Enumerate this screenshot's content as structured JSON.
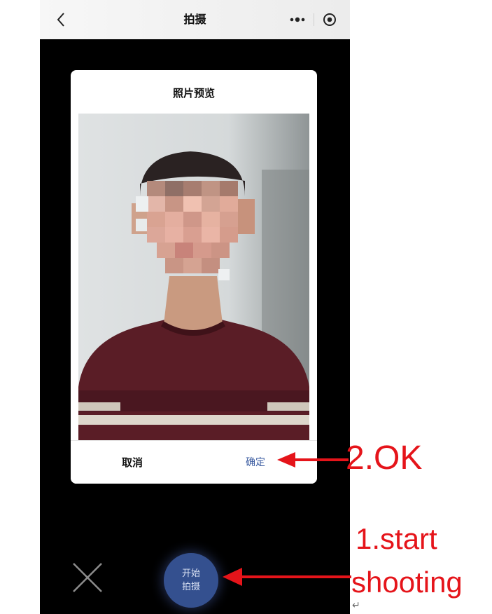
{
  "navbar": {
    "title": "拍摄",
    "back_icon": "chevron-left-icon",
    "more_icon": "more-dots-icon",
    "close_icon": "target-circle-icon"
  },
  "dialog": {
    "title": "照片预览",
    "cancel_label": "取消",
    "confirm_label": "确定",
    "confirm_color": "#3a5ba0"
  },
  "camera": {
    "shoot_label_line1": "开始",
    "shoot_label_line2": "拍摄",
    "close_icon": "close-x-icon"
  },
  "annotations": {
    "ok_label": "2.OK",
    "start_label_line1": "1.start",
    "start_label_line2": "shooting",
    "color": "#e5141a"
  },
  "misc": {
    "return_glyph": "↵"
  }
}
